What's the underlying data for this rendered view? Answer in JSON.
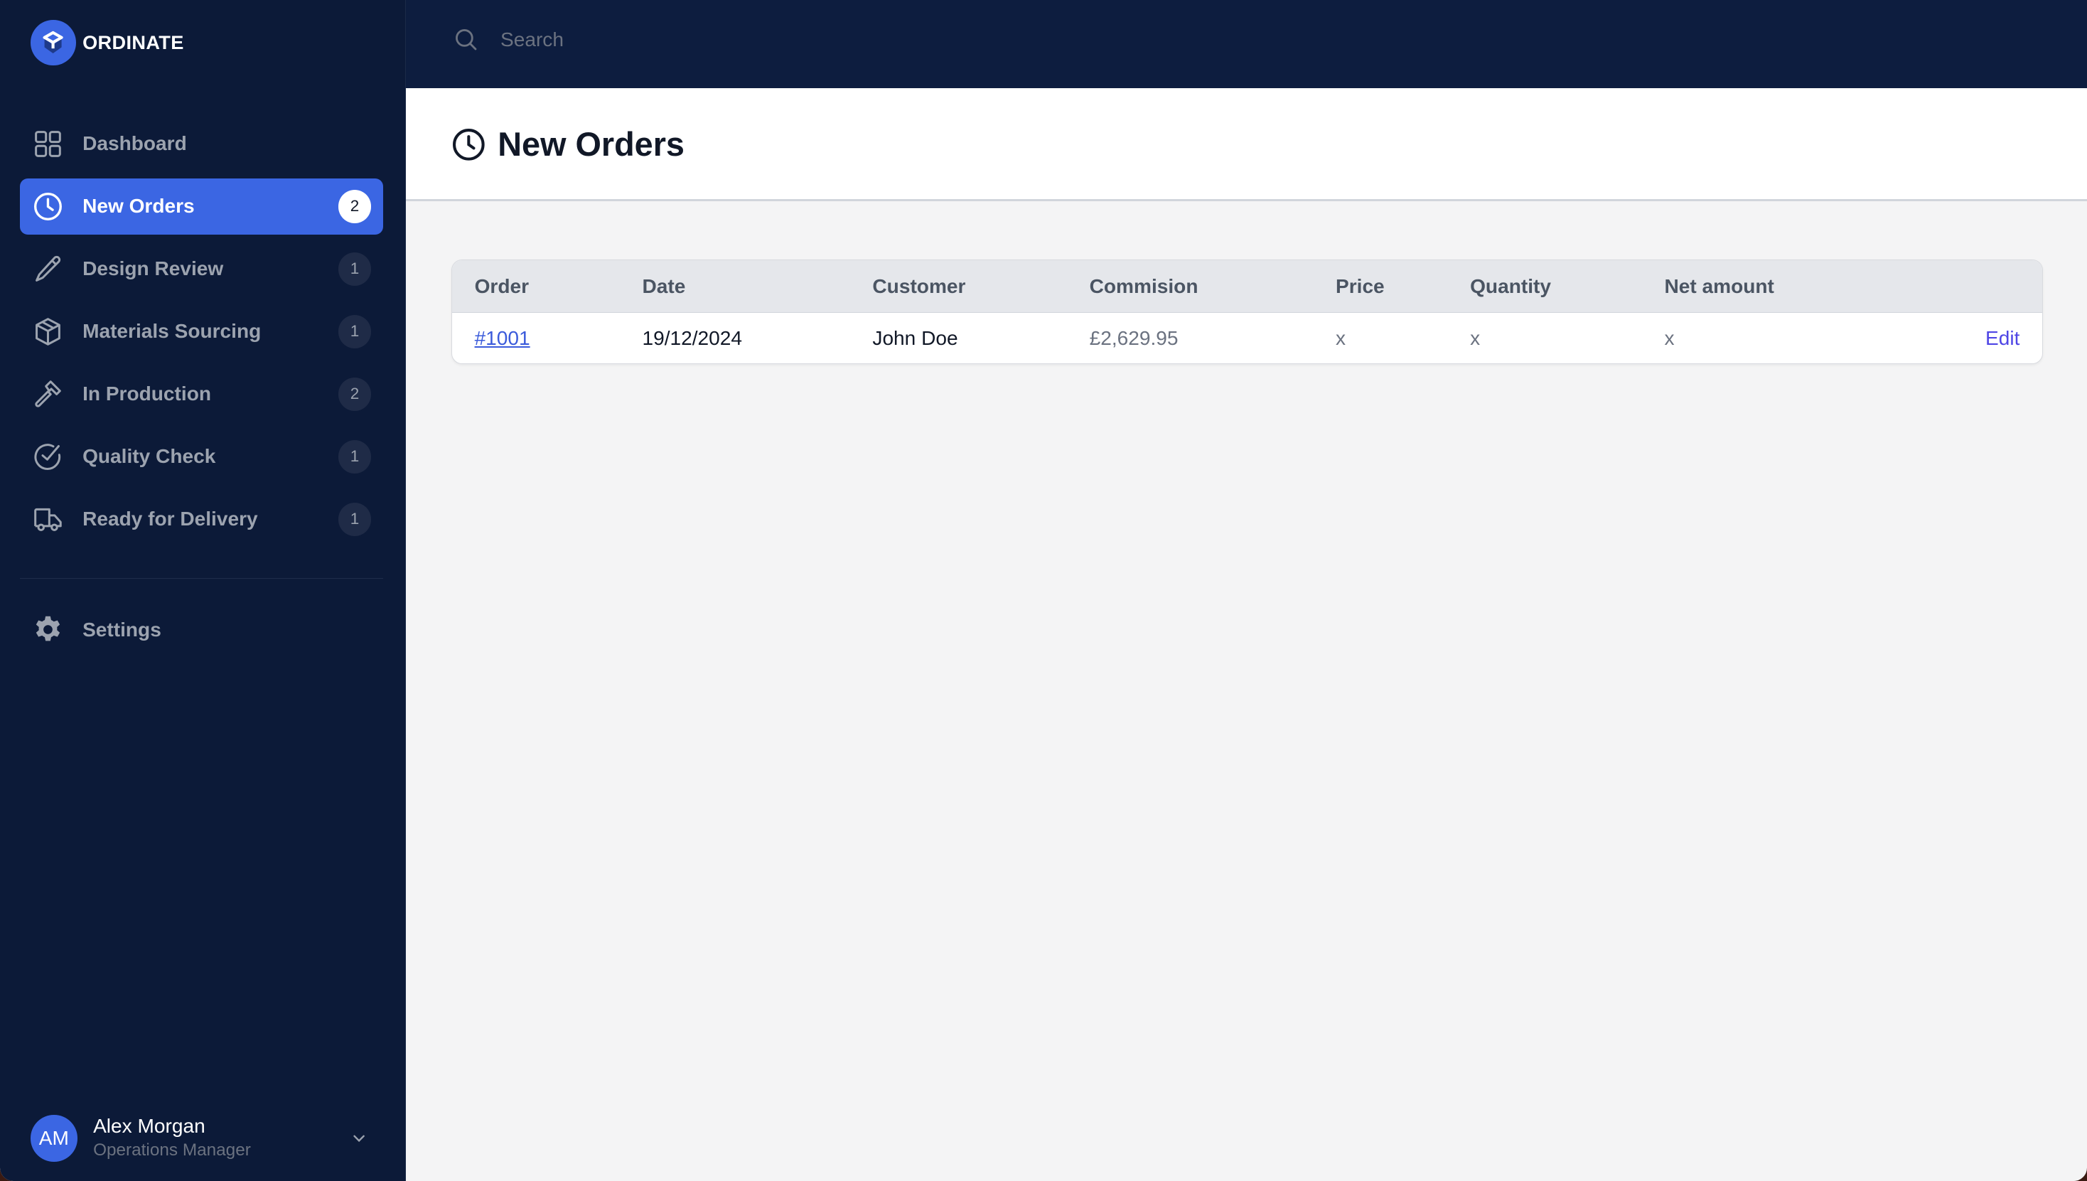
{
  "brand": {
    "name": "ORDINATE",
    "accent": "#3b66e3"
  },
  "sidebar": {
    "items": [
      {
        "label": "Dashboard",
        "icon": "grid-icon",
        "badge": null,
        "active": false
      },
      {
        "label": "New Orders",
        "icon": "clock-icon",
        "badge": "2",
        "active": true
      },
      {
        "label": "Design Review",
        "icon": "pencil-icon",
        "badge": "1",
        "active": false
      },
      {
        "label": "Materials Sourcing",
        "icon": "box-icon",
        "badge": "1",
        "active": false
      },
      {
        "label": "In Production",
        "icon": "hammer-icon",
        "badge": "2",
        "active": false
      },
      {
        "label": "Quality Check",
        "icon": "check-circle-icon",
        "badge": "1",
        "active": false
      },
      {
        "label": "Ready for Delivery",
        "icon": "truck-icon",
        "badge": "1",
        "active": false
      }
    ],
    "settings": {
      "label": "Settings",
      "icon": "gear-icon"
    },
    "user": {
      "initials": "AM",
      "name": "Alex Morgan",
      "role": "Operations Manager"
    }
  },
  "topbar": {
    "search_placeholder": "Search",
    "search_value": ""
  },
  "page": {
    "title": "New Orders"
  },
  "table": {
    "columns": [
      "Order",
      "Date",
      "Customer",
      "Commision",
      "Price",
      "Quantity",
      "Net amount",
      ""
    ],
    "rows": [
      {
        "order": "#1001",
        "date": "19/12/2024",
        "customer": "John Doe",
        "commission": "£2,629.95",
        "price": "x",
        "quantity": "x",
        "net_amount": "x",
        "action": "Edit"
      }
    ]
  }
}
